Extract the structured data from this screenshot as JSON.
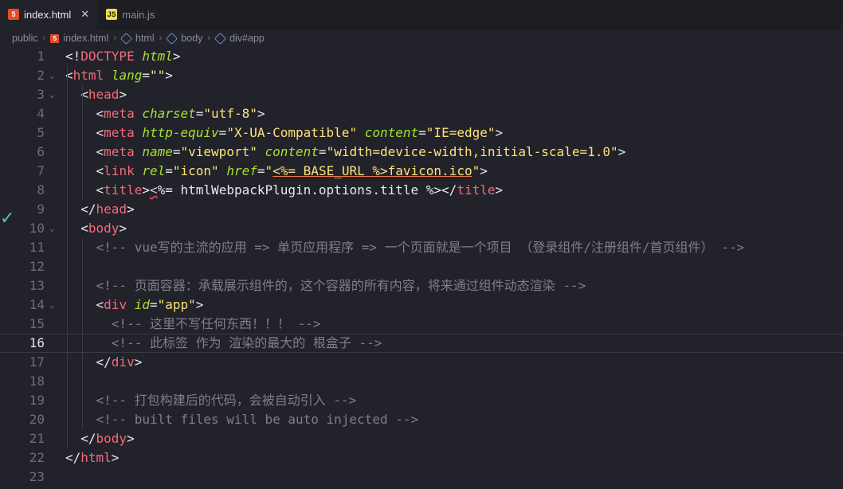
{
  "tabs": [
    {
      "label": "index.html",
      "icon": "html5-icon",
      "active": true
    },
    {
      "label": "main.js",
      "icon": "js-icon",
      "active": false
    }
  ],
  "tab_close_glyph": "✕",
  "breadcrumb": [
    "public",
    "index.html",
    "html",
    "body",
    "div#app"
  ],
  "lines": [
    {
      "n": "1",
      "code": [
        [
          "p",
          "<!"
        ],
        [
          "t",
          "DOCTYPE"
        ],
        [
          "p",
          " "
        ],
        [
          "a",
          "html"
        ],
        [
          "p",
          ">"
        ]
      ]
    },
    {
      "n": "2",
      "code": [
        [
          "p",
          "<"
        ],
        [
          "t",
          "html"
        ],
        [
          "p",
          " "
        ],
        [
          "a",
          "lang"
        ],
        [
          "p",
          "="
        ],
        [
          "s",
          "\"\""
        ],
        [
          "p",
          ">"
        ]
      ]
    },
    {
      "n": "3",
      "code": [
        [
          "p",
          "<"
        ],
        [
          "t",
          "head"
        ],
        [
          "p",
          ">"
        ]
      ]
    },
    {
      "n": "4",
      "code": [
        [
          "p",
          "<"
        ],
        [
          "t",
          "meta"
        ],
        [
          "p",
          " "
        ],
        [
          "a",
          "charset"
        ],
        [
          "p",
          "="
        ],
        [
          "s",
          "\"utf-8\""
        ],
        [
          "p",
          ">"
        ]
      ]
    },
    {
      "n": "5",
      "code": [
        [
          "p",
          "<"
        ],
        [
          "t",
          "meta"
        ],
        [
          "p",
          " "
        ],
        [
          "a",
          "http-equiv"
        ],
        [
          "p",
          "="
        ],
        [
          "s",
          "\"X-UA-Compatible\""
        ],
        [
          "p",
          " "
        ],
        [
          "a",
          "content"
        ],
        [
          "p",
          "="
        ],
        [
          "s",
          "\"IE=edge\""
        ],
        [
          "p",
          ">"
        ]
      ]
    },
    {
      "n": "6",
      "code": [
        [
          "p",
          "<"
        ],
        [
          "t",
          "meta"
        ],
        [
          "p",
          " "
        ],
        [
          "a",
          "name"
        ],
        [
          "p",
          "="
        ],
        [
          "s",
          "\"viewport\""
        ],
        [
          "p",
          " "
        ],
        [
          "a",
          "content"
        ],
        [
          "p",
          "="
        ],
        [
          "s",
          "\"width=device-width,initial-scale=1.0\""
        ],
        [
          "p",
          ">"
        ]
      ]
    },
    {
      "n": "7",
      "code": [
        [
          "p",
          "<"
        ],
        [
          "t",
          "link"
        ],
        [
          "p",
          " "
        ],
        [
          "a",
          "rel"
        ],
        [
          "p",
          "="
        ],
        [
          "s",
          "\"icon\""
        ],
        [
          "p",
          " "
        ],
        [
          "a",
          "href"
        ],
        [
          "p",
          "="
        ],
        [
          "s",
          "\""
        ],
        [
          "ej",
          "<%= BASE_URL %>favicon.ico"
        ],
        [
          "s",
          "\""
        ],
        [
          "p",
          ">"
        ]
      ]
    },
    {
      "n": "8",
      "code": [
        [
          "p",
          "<"
        ],
        [
          "t",
          "title"
        ],
        [
          "p",
          ">"
        ],
        [
          "warn",
          "<"
        ],
        [
          "p",
          "%= htmlWebpackPlugin.options.title %></"
        ],
        [
          "t",
          "title"
        ],
        [
          "p",
          ">"
        ]
      ]
    },
    {
      "n": "9",
      "code": [
        [
          "p",
          "</"
        ],
        [
          "t",
          "head"
        ],
        [
          "p",
          ">"
        ]
      ]
    },
    {
      "n": "10",
      "code": [
        [
          "p",
          "<"
        ],
        [
          "t",
          "body"
        ],
        [
          "p",
          ">"
        ]
      ]
    },
    {
      "n": "11",
      "code": [
        [
          "c",
          "<!-- vue写的主流的应用 => 单页应用程序 => 一个页面就是一个项目 （登录组件/注册组件/首页组件） -->"
        ]
      ]
    },
    {
      "n": "12",
      "code": []
    },
    {
      "n": "13",
      "code": [
        [
          "c",
          "<!-- 页面容器：承载展示组件的，这个容器的所有内容，将来通过组件动态渲染 -->"
        ]
      ]
    },
    {
      "n": "14",
      "code": [
        [
          "p",
          "<"
        ],
        [
          "t",
          "div"
        ],
        [
          "p",
          " "
        ],
        [
          "a",
          "id"
        ],
        [
          "p",
          "="
        ],
        [
          "s",
          "\"app\""
        ],
        [
          "p",
          ">"
        ]
      ]
    },
    {
      "n": "15",
      "code": [
        [
          "c",
          "<!-- 这里不写任何东西！！！ -->"
        ]
      ]
    },
    {
      "n": "16",
      "code": [
        [
          "c",
          "<!-- 此标签 作为 渲染的最大的 根盒子 -->"
        ]
      ]
    },
    {
      "n": "17",
      "code": [
        [
          "p",
          "</"
        ],
        [
          "t",
          "div"
        ],
        [
          "p",
          ">"
        ]
      ]
    },
    {
      "n": "18",
      "code": []
    },
    {
      "n": "19",
      "code": [
        [
          "c",
          "<!-- 打包构建后的代码，会被自动引入 -->"
        ]
      ]
    },
    {
      "n": "20",
      "code": [
        [
          "c",
          "<!-- built files will be auto injected -->"
        ]
      ]
    },
    {
      "n": "21",
      "code": [
        [
          "p",
          "</"
        ],
        [
          "t",
          "body"
        ],
        [
          "p",
          ">"
        ]
      ]
    },
    {
      "n": "22",
      "code": [
        [
          "p",
          "</"
        ],
        [
          "t",
          "html"
        ],
        [
          "p",
          ">"
        ]
      ]
    },
    {
      "n": "23",
      "code": []
    }
  ],
  "current_line": "16",
  "gutter_marker": "check-icon"
}
